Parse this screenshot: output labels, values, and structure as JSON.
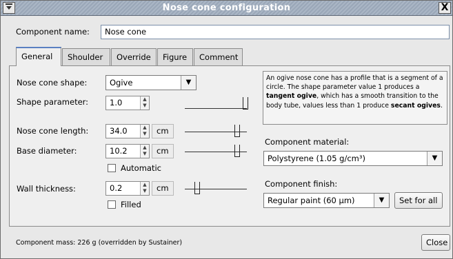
{
  "window": {
    "title": "Nose cone configuration",
    "menu_glyph": "⧩",
    "close_glyph": "X"
  },
  "component_name": {
    "label": "Component name:",
    "value": "Nose cone"
  },
  "tabs": [
    {
      "label": "General",
      "active": true
    },
    {
      "label": "Shoulder"
    },
    {
      "label": "Override"
    },
    {
      "label": "Figure"
    },
    {
      "label": "Comment"
    }
  ],
  "general": {
    "shape": {
      "label": "Nose cone shape:",
      "value": "Ogive"
    },
    "shape_parameter": {
      "label": "Shape parameter:",
      "value": "1.0"
    },
    "length": {
      "label": "Nose cone length:",
      "value": "34.0",
      "unit": "cm"
    },
    "base_diameter": {
      "label": "Base diameter:",
      "value": "10.2",
      "unit": "cm"
    },
    "automatic": {
      "label": "Automatic",
      "checked": false
    },
    "wall_thickness": {
      "label": "Wall thickness:",
      "value": "0.2",
      "unit": "cm"
    },
    "filled": {
      "label": "Filled",
      "checked": false
    },
    "description": {
      "p1": "An ogive nose cone has a profile that is a segment of a circle. The shape parameter value 1 produces a ",
      "b1": "tangent ogive",
      "p2": ", which has a smooth transition to the body tube, values less than 1 produce ",
      "b2": "secant ogives",
      "p3": "."
    },
    "material": {
      "label": "Component material:",
      "value": "Polystyrene (1.05 g/cm³)"
    },
    "finish": {
      "label": "Component finish:",
      "value": "Regular paint (60 μm)",
      "set_for_all": "Set for all"
    }
  },
  "footer": {
    "mass": "Component mass: 226 g (overridden by Sustainer)",
    "close": "Close"
  }
}
